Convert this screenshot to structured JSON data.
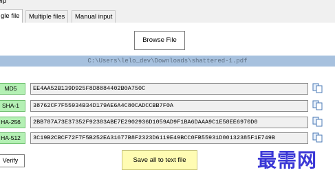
{
  "menu": {
    "help": "elp"
  },
  "tabs": [
    {
      "label": "gle file"
    },
    {
      "label": "Multiple files"
    },
    {
      "label": "Manual input"
    }
  ],
  "browse_button": "Browse File",
  "file_path": "C:\\Users\\lelo_dev\\Downloads\\shattered-1.pdf",
  "hashes": [
    {
      "label": "MD5",
      "value": "EE4AA52B139D925F8D8884402B0A750C"
    },
    {
      "label": "SHA-1",
      "value": "38762CF7F55934B34D179AE6A4C80CADCCBB7F0A"
    },
    {
      "label": "HA-256",
      "value": "2BB787A73E37352F92383ABE7E2902936D1059AD9F1BA6DAAA9C1E58EE6970D0"
    },
    {
      "label": "HA-512",
      "value": "3C19B2CBCF72F7F5B252EA31677B8F2323D6119E49BCC0FB55931D00132385F1E749B"
    }
  ],
  "verify_button": "Verify",
  "save_button": "Save all to text file",
  "watermark": "最需网"
}
